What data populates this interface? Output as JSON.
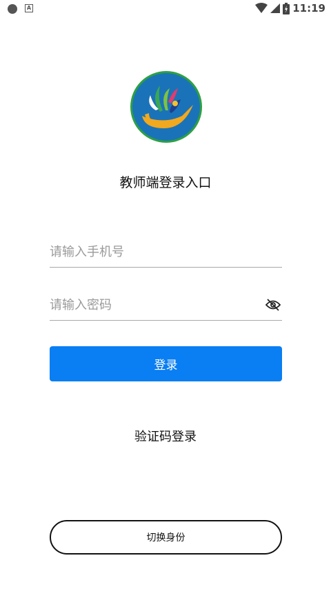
{
  "status_bar": {
    "time": "11:19",
    "icons": [
      "notification-dot-icon",
      "app-notice-icon",
      "wifi-icon",
      "signal-icon",
      "battery-icon"
    ]
  },
  "header": {
    "title": "教师端登录入口"
  },
  "form": {
    "phone_placeholder": "请输入手机号",
    "password_placeholder": "请输入密码",
    "login_label": "登录"
  },
  "links": {
    "sms_login": "验证码登录"
  },
  "footer": {
    "switch_role_label": "切换身份"
  },
  "colors": {
    "primary": "#0a7ef3",
    "logo_ring": "#2ea043",
    "logo_bg": "#1a73b8",
    "logo_boat": "#f2a81f"
  }
}
